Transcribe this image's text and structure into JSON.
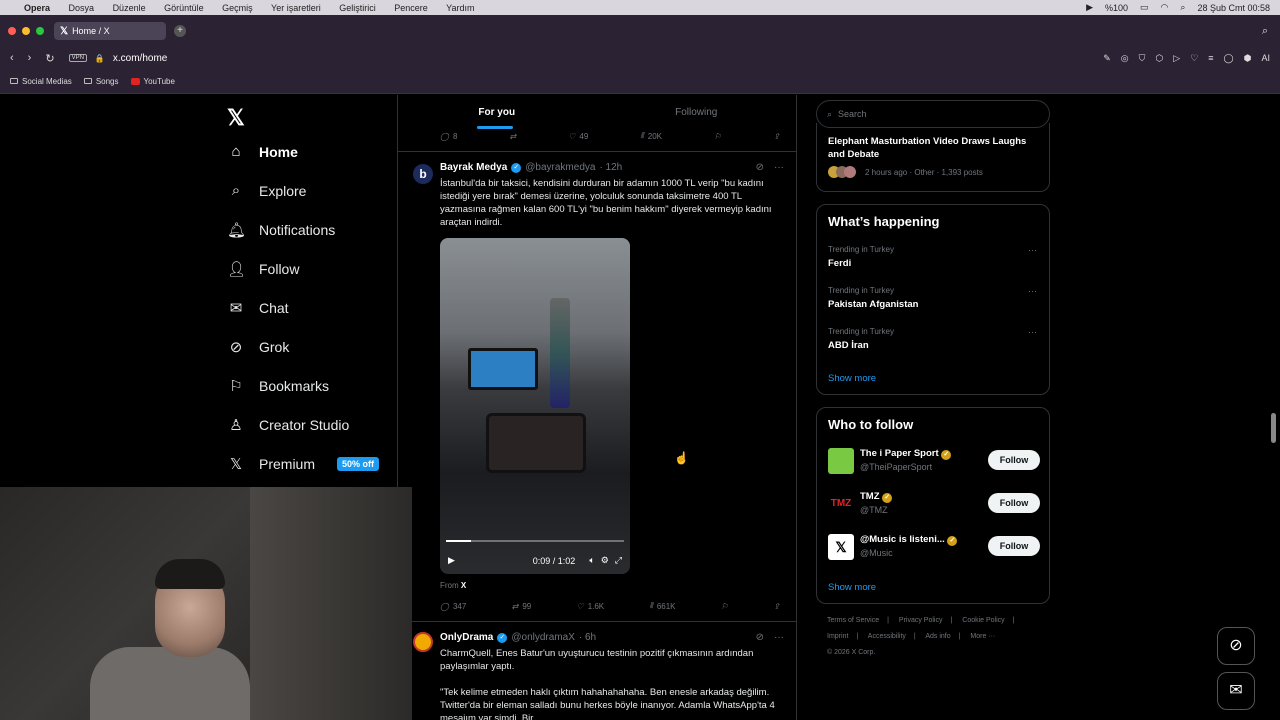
{
  "macos": {
    "app": "Opera",
    "menu": [
      "Dosya",
      "Düzenle",
      "Görüntüle",
      "Geçmiş",
      "Yer işaretleri",
      "Geliştirici",
      "Pencere",
      "Yardım"
    ],
    "battery": "%100",
    "datetime": "28 Şub Cmt  00:58"
  },
  "browser": {
    "tab_title": "Home / X",
    "url": "x.com/home",
    "vpn_label": "VPN",
    "ai_label": "AI",
    "bookmarks": [
      "Social Medias",
      "Songs",
      "YouTube"
    ]
  },
  "nav": {
    "items": [
      {
        "label": "Home",
        "icon": "home-icon"
      },
      {
        "label": "Explore",
        "icon": "search-icon"
      },
      {
        "label": "Notifications",
        "icon": "bell-icon"
      },
      {
        "label": "Follow",
        "icon": "add-user-icon"
      },
      {
        "label": "Chat",
        "icon": "mail-icon"
      },
      {
        "label": "Grok",
        "icon": "grok-icon"
      },
      {
        "label": "Bookmarks",
        "icon": "bookmark-icon"
      },
      {
        "label": "Creator Studio",
        "icon": "creator-icon"
      },
      {
        "label": "Premium",
        "icon": "x-icon"
      }
    ],
    "premium_badge": "50% off"
  },
  "feed": {
    "tabs": [
      "For you",
      "Following"
    ],
    "prev_actions": {
      "replies": "8",
      "reposts": "",
      "likes": "49",
      "views": "20K"
    },
    "tweet1": {
      "name": "Bayrak Medya",
      "handle": "@bayrakmedya",
      "time": "· 12h",
      "text": "İstanbul'da bir taksici, kendisini durduran bir adamın 1000 TL verip \"bu kadını istediği yere bırak\" demesi üzerine, yolculuk sonunda taksimetre 400 TL yazmasına rağmen kalan 600 TL'yi \"bu benim hakkım\" diyerek vermeyip kadını araçtan indirdi.",
      "video_time": "0:09 / 1:02",
      "video_progress": 0.14,
      "from_label": "From",
      "from_source": "X",
      "replies": "347",
      "reposts": "99",
      "likes": "1.6K",
      "views": "661K"
    },
    "tweet2": {
      "name": "OnlyDrama",
      "handle": "@onlydramaX",
      "time": "· 6h",
      "text1": "CharmQuell, Enes Batur'un uyuşturucu testinin pozitif çıkmasının ardından paylaşımlar yaptı.",
      "text2": "\"Tek kelime etmeden haklı çıktım hahahahahaha. Ben enesle arkadaş değilim. Twitter'da bir eleman salladı bunu herkes böyle inanıyor. Adamla WhatsApp'ta 4 mesajım var şimdi. Bir"
    }
  },
  "right": {
    "search_placeholder": "Search",
    "news": {
      "title": "Elephant Masturbation Video Draws Laughs and Debate",
      "meta": "2 hours ago · Other · 1,393 posts"
    },
    "happening": {
      "heading": "What’s happening",
      "trends": [
        {
          "meta": "Trending in Turkey",
          "title": "Ferdi"
        },
        {
          "meta": "Trending in Turkey",
          "title": "Pakistan Afganistan"
        },
        {
          "meta": "Trending in Turkey",
          "title": "ABD İran"
        }
      ],
      "show_more": "Show more"
    },
    "who_to_follow": {
      "heading": "Who to follow",
      "accounts": [
        {
          "name": "The i Paper Sport",
          "handle": "@TheiPaperSport",
          "button": "Follow",
          "color": "#7ac943"
        },
        {
          "name": "TMZ",
          "handle": "@TMZ",
          "button": "Follow",
          "color": "#000000"
        },
        {
          "name": "@Music is listeni...",
          "handle": "@Music",
          "button": "Follow",
          "color": "#ffffff"
        }
      ],
      "show_more": "Show more"
    },
    "footer": {
      "links": [
        "Terms of Service",
        "|",
        "Privacy Policy",
        "|",
        "Cookie Policy",
        "|",
        "Imprint",
        "|",
        "Accessibility",
        "|",
        "Ads info",
        "|",
        "More ···"
      ],
      "copyright": "© 2026 X Corp."
    }
  }
}
